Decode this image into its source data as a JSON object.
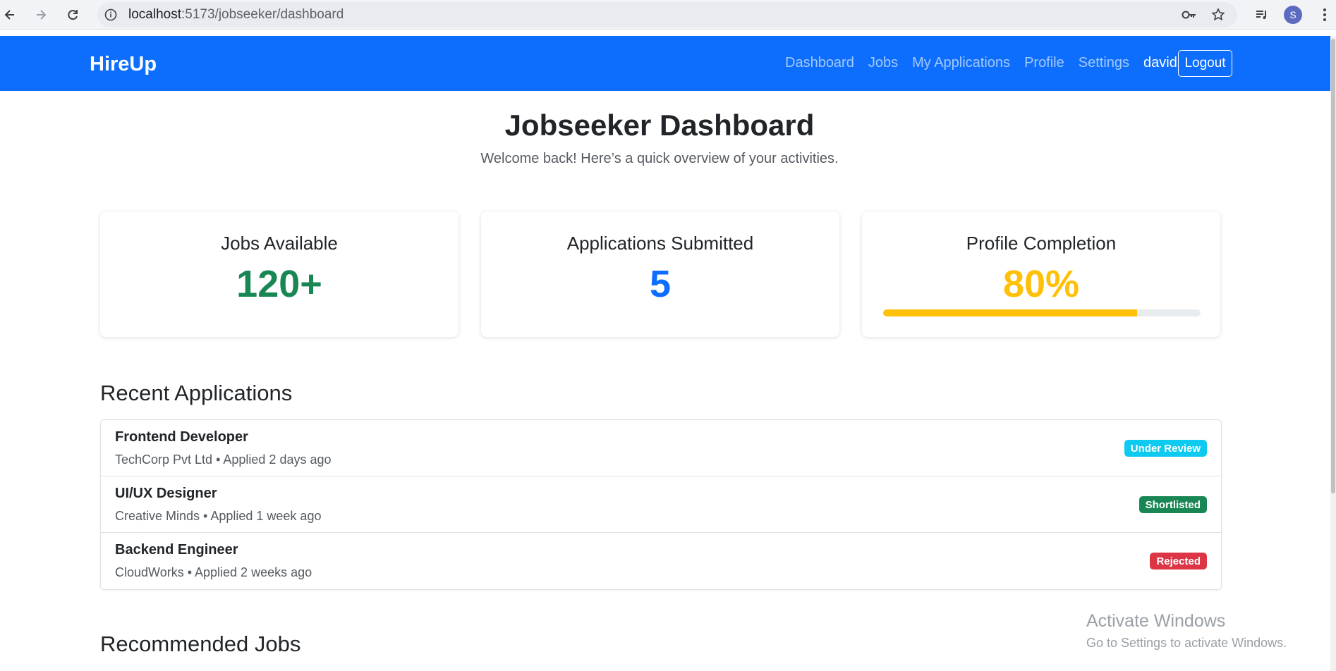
{
  "browser": {
    "url_host": "localhost",
    "url_rest": ":5173/jobseeker/dashboard",
    "profile_initial": "S"
  },
  "navbar": {
    "brand": "HireUp",
    "links": [
      "Dashboard",
      "Jobs",
      "My Applications",
      "Profile",
      "Settings"
    ],
    "username": "david",
    "logout_label": "Logout"
  },
  "header": {
    "title": "Jobseeker Dashboard",
    "subtitle": "Welcome back! Here’s a quick overview of your activities."
  },
  "stats": [
    {
      "label": "Jobs Available",
      "value": "120+",
      "color": "#198754"
    },
    {
      "label": "Applications Submitted",
      "value": "5",
      "color": "#0d6efd"
    },
    {
      "label": "Profile Completion",
      "value": "80%",
      "color": "#ffc107",
      "progress": 0.8
    }
  ],
  "recent_applications": {
    "title": "Recent Applications",
    "items": [
      {
        "title": "Frontend Developer",
        "meta": "TechCorp Pvt Ltd • Applied 2 days ago",
        "status": "Under Review",
        "status_color": "#0dcaf0"
      },
      {
        "title": "UI/UX Designer",
        "meta": "Creative Minds • Applied 1 week ago",
        "status": "Shortlisted",
        "status_color": "#198754"
      },
      {
        "title": "Backend Engineer",
        "meta": "CloudWorks • Applied 2 weeks ago",
        "status": "Rejected",
        "status_color": "#dc3545"
      }
    ]
  },
  "recommended_jobs": {
    "title": "Recommended Jobs"
  },
  "watermark": {
    "line1": "Activate Windows",
    "line2": "Go to Settings to activate Windows."
  },
  "icons": {
    "back": "arrow-left-icon",
    "forward": "arrow-right-icon",
    "reload": "reload-icon",
    "site_info": "info-icon",
    "password": "key-icon",
    "bookmark": "star-icon",
    "media": "media-icon",
    "menu": "kebab-menu-icon"
  }
}
